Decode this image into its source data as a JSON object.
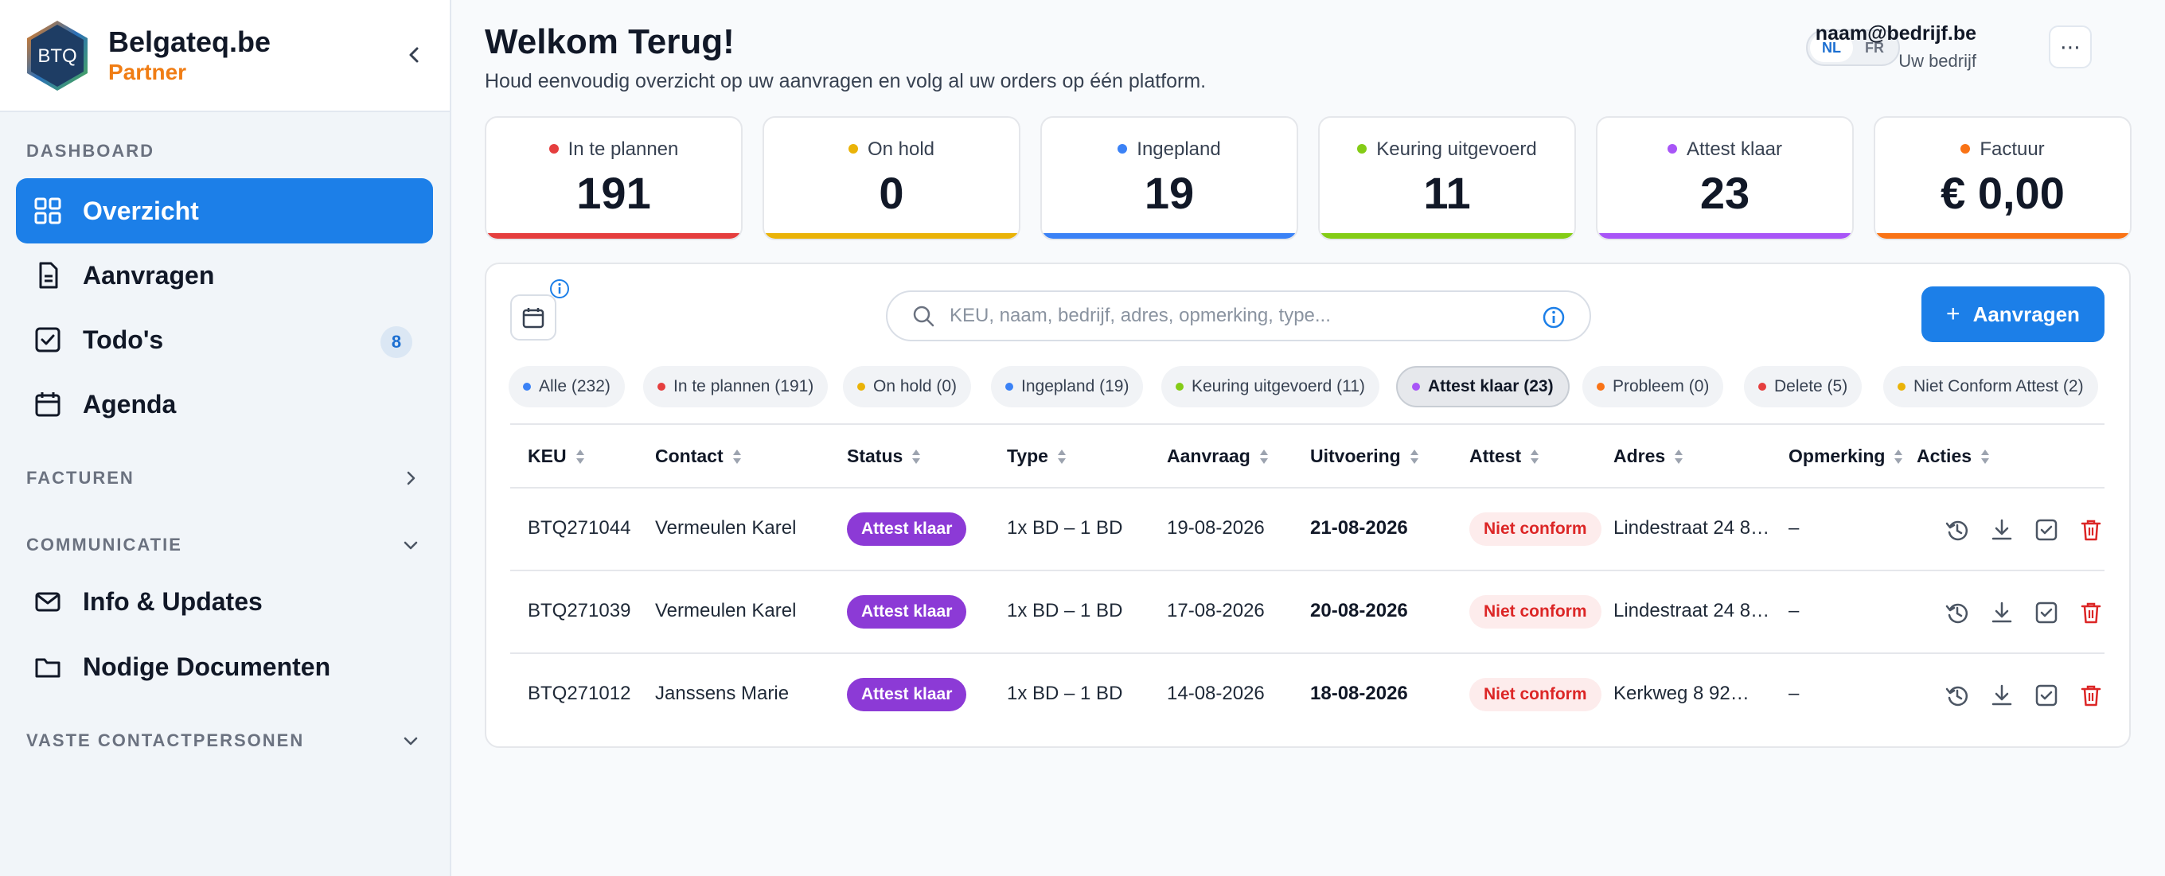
{
  "brand": {
    "logo_text": "BTQ",
    "name": "Belgateq.be",
    "sub": "Partner"
  },
  "nav": {
    "section_dashboard": "DASHBOARD",
    "overzicht": "Overzicht",
    "aanvragen": "Aanvragen",
    "todos": "Todo's",
    "todos_badge": "8",
    "agenda": "Agenda",
    "section_facturen": "FACTUREN",
    "section_communicatie": "COMMUNICATIE",
    "info_updates": "Info & Updates",
    "documenten": "Nodige Documenten",
    "section_contact": "VASTE CONTACTPERSONEN"
  },
  "header": {
    "title": "Welkom Terug!",
    "subtitle": "Houd eenvoudig overzicht op uw aanvragen en volg al uw orders op één platform.",
    "lang_nl": "NL",
    "lang_fr": "FR",
    "user_email": "naam@bedrijf.be",
    "user_company": "Uw bedrijf",
    "more": "⋯"
  },
  "stats": [
    {
      "label": "In te plannen",
      "value": "191",
      "color": "#e53e3e"
    },
    {
      "label": "On hold",
      "value": "0",
      "color": "#eab308"
    },
    {
      "label": "Ingepland",
      "value": "19",
      "color": "#3b82f6"
    },
    {
      "label": "Keuring uitgevoerd",
      "value": "11",
      "color": "#84cc16"
    },
    {
      "label": "Attest klaar",
      "value": "23",
      "color": "#a855f7"
    },
    {
      "label": "Factuur",
      "value": "€ 0,00",
      "color": "#f97316"
    }
  ],
  "toolbar": {
    "search_placeholder": "KEU, naam, bedrijf, adres, opmerking, type...",
    "add_label": "Aanvragen",
    "add_plus": "+"
  },
  "filters": [
    {
      "label": "Alle (232)",
      "color": "#3b82f6"
    },
    {
      "label": "In te plannen (191)",
      "color": "#e53e3e"
    },
    {
      "label": "On hold (0)",
      "color": "#eab308"
    },
    {
      "label": "Ingepland (19)",
      "color": "#3b82f6"
    },
    {
      "label": "Keuring uitgevoerd (11)",
      "color": "#84cc16"
    },
    {
      "label": "Attest klaar (23)",
      "color": "#a855f7"
    },
    {
      "label": "Probleem (0)",
      "color": "#f97316"
    },
    {
      "label": "Delete (5)",
      "color": "#e53e3e"
    },
    {
      "label": "Niet Conform Attest (2)",
      "color": "#eab308"
    }
  ],
  "table": {
    "columns": [
      "KEU",
      "Contact",
      "Status",
      "Type",
      "Aanvraag",
      "Uitvoering",
      "Attest",
      "Adres",
      "Opmerking",
      "Acties"
    ],
    "rows": [
      {
        "keu": "BTQ271044",
        "contact": "Vermeulen Karel",
        "status": "Attest klaar",
        "type": "1x BD – 1 BD",
        "aanvraag": "19-08-2026",
        "uitvoering": "21-08-2026",
        "attest": "Niet conform",
        "adres": "Lindestraat 24 8…",
        "opmerking": "–"
      },
      {
        "keu": "BTQ271039",
        "contact": "Vermeulen Karel",
        "status": "Attest klaar",
        "type": "1x BD – 1 BD",
        "aanvraag": "17-08-2026",
        "uitvoering": "20-08-2026",
        "attest": "Niet conform",
        "adres": "Lindestraat 24 8…",
        "opmerking": "–"
      },
      {
        "keu": "BTQ271012",
        "contact": "Janssens Marie",
        "status": "Attest klaar",
        "type": "1x BD – 1 BD",
        "aanvraag": "14-08-2026",
        "uitvoering": "18-08-2026",
        "attest": "Niet conform",
        "adres": "Kerkweg 8 92…",
        "opmerking": "–"
      }
    ]
  }
}
